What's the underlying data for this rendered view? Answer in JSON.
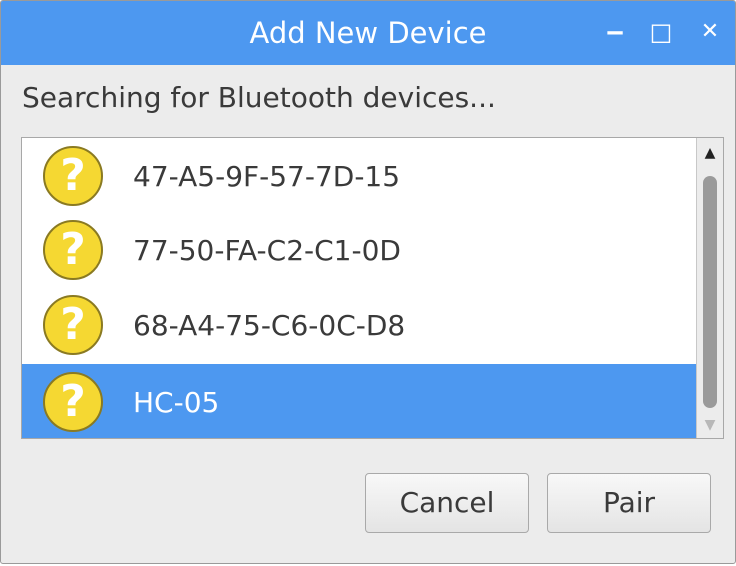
{
  "window": {
    "title": "Add New Device",
    "minimize_glyph": "‒",
    "maximize_glyph": "□",
    "close_glyph": "✕"
  },
  "status_text": "Searching for Bluetooth devices...",
  "devices": [
    {
      "name": "47-A5-9F-57-7D-15",
      "icon": "unknown-device-question-icon",
      "selected": false
    },
    {
      "name": "77-50-FA-C2-C1-0D",
      "icon": "unknown-device-question-icon",
      "selected": false
    },
    {
      "name": "68-A4-75-C6-0C-D8",
      "icon": "unknown-device-question-icon",
      "selected": false
    },
    {
      "name": "HC-05",
      "icon": "unknown-device-question-icon",
      "selected": true
    }
  ],
  "icon_glyph": "?",
  "scrollbar": {
    "up_glyph": "▲",
    "down_glyph": "▼"
  },
  "buttons": {
    "cancel_label": "Cancel",
    "pair_label": "Pair"
  },
  "colors": {
    "accent": "#4d98f0",
    "icon_yellow": "#f5d832",
    "window_bg": "#ececec"
  }
}
